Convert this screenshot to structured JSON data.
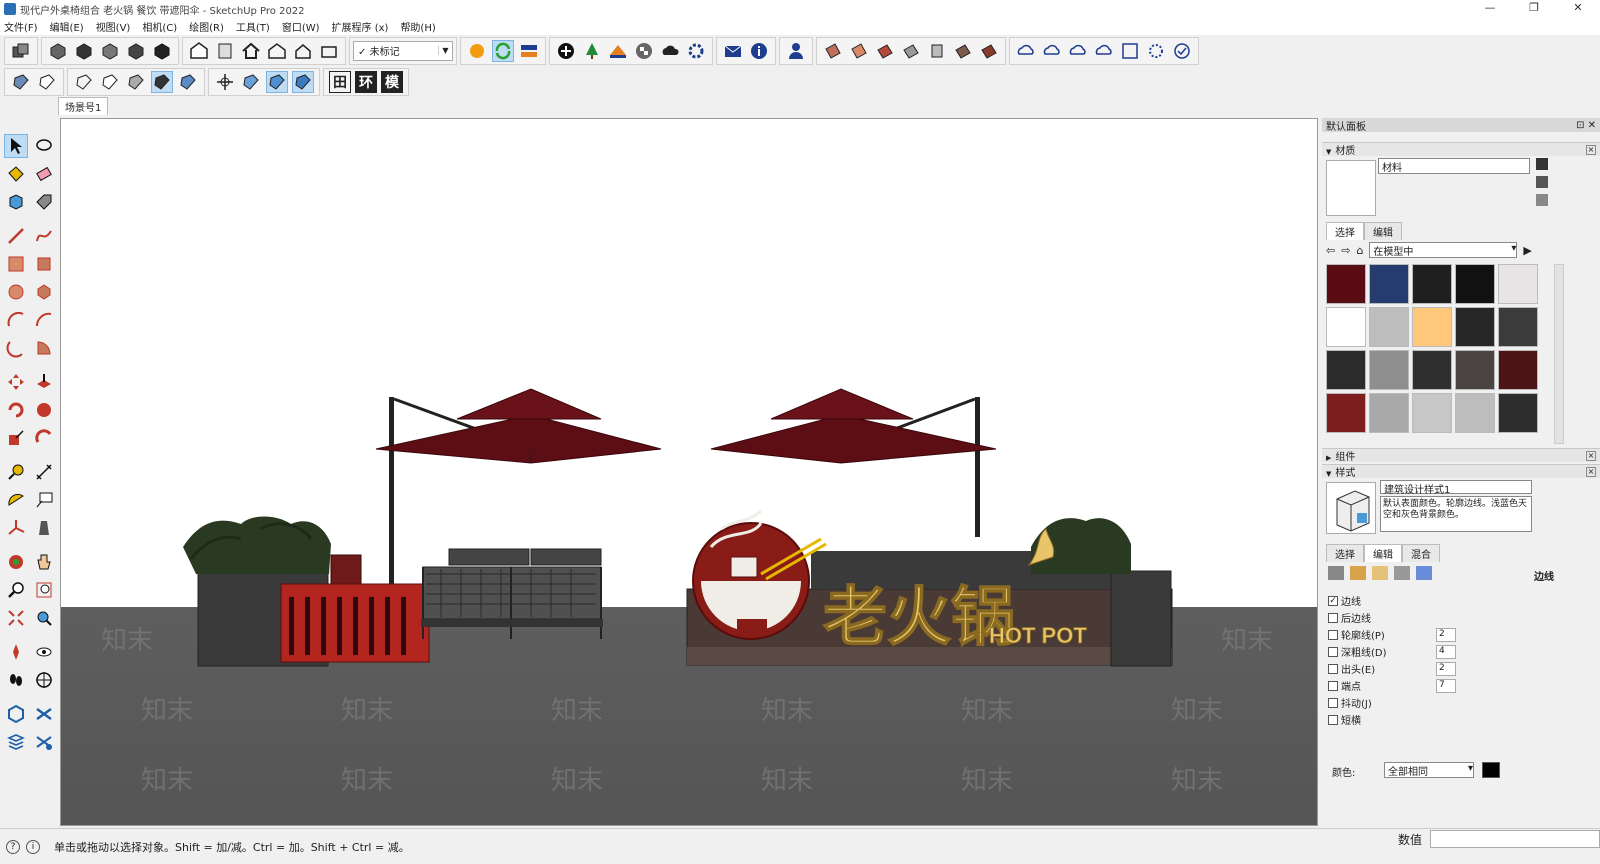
{
  "window": {
    "title": "现代户外桌椅组合 老火锅 餐饮 带遮阳伞 - SketchUp Pro 2022",
    "controls": [
      "—",
      "❐",
      "✕"
    ]
  },
  "menu": [
    "文件(F)",
    "编辑(E)",
    "视图(V)",
    "相机(C)",
    "绘图(R)",
    "工具(T)",
    "窗口(W)",
    "扩展程序 (x)",
    "帮助(H)"
  ],
  "toolbar": {
    "tag_select": "未标记",
    "tag_check": "✓"
  },
  "toolbar2": {
    "txt1": "田",
    "txt2": "环",
    "txt3": "模"
  },
  "scene_tab": "场景号1",
  "viewport": {
    "sign_cn": "老火锅",
    "sign_en": "HOT POT",
    "watermark": "知末"
  },
  "status": {
    "text": "单击或拖动以选择对象。Shift = 加/减。Ctrl = 加。Shift + Ctrl = 减。",
    "measure_label": "数值"
  },
  "panel": {
    "title": "默认面板",
    "sections": {
      "materials": "材质",
      "components": "组件",
      "styles": "样式"
    },
    "material_name": "材料",
    "mat_tabs": [
      "选择",
      "编辑"
    ],
    "library": "在模型中",
    "swatches": [
      "#5a0c14",
      "#263b6e",
      "#1f1f1f",
      "#111111",
      "#e6e4e4",
      "#ffffff",
      "#bdbdbd",
      "#ffc77a",
      "#262626",
      "#3b3b3b",
      "#2c2c2c",
      "#8e8e8e",
      "#2f2f2f",
      "#4a4442",
      "#4c1416",
      "#7d1d1d",
      "#a9a9a9",
      "#c7c7c7",
      "#bdbdbd",
      "#2d2d2d"
    ],
    "style_name": "建筑设计样式1",
    "style_desc": "默认表面颜色。轮廓边线。浅蓝色天空和灰色背景颜色。",
    "style_tabs": [
      "选择",
      "编辑",
      "混合"
    ],
    "edges_label": "边线",
    "edge_options": [
      {
        "label": "边线",
        "checked": true,
        "value": ""
      },
      {
        "label": "后边线",
        "checked": false,
        "value": ""
      },
      {
        "label": "轮廓线(P)",
        "checked": false,
        "value": "2"
      },
      {
        "label": "深粗线(D)",
        "checked": false,
        "value": "4"
      },
      {
        "label": "出头(E)",
        "checked": false,
        "value": "2"
      },
      {
        "label": "端点",
        "checked": false,
        "value": "7"
      },
      {
        "label": "抖动(J)",
        "checked": false,
        "value": ""
      },
      {
        "label": "短横",
        "checked": false,
        "value": ""
      }
    ],
    "color_label": "颜色:",
    "color_value": "全部相同"
  }
}
